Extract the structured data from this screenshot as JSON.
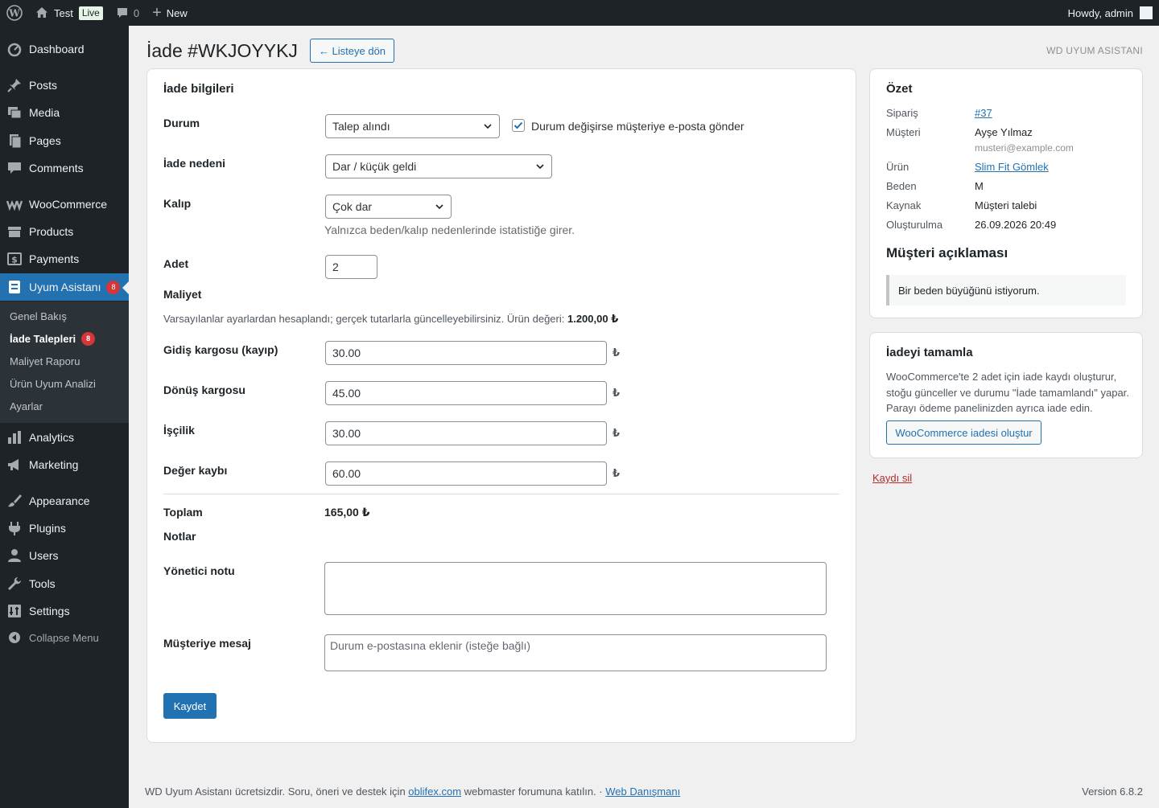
{
  "adminbar": {
    "site_name": "Test",
    "live_badge": "Live",
    "comments_count": "0",
    "new_label": "New",
    "howdy": "Howdy, admin"
  },
  "sidebar": {
    "items": [
      {
        "label": "Dashboard",
        "icon": "dashboard-icon"
      },
      {
        "label": "Posts",
        "icon": "pin-icon"
      },
      {
        "label": "Media",
        "icon": "media-icon"
      },
      {
        "label": "Pages",
        "icon": "pages-icon"
      },
      {
        "label": "Comments",
        "icon": "comment-icon"
      },
      {
        "label": "WooCommerce",
        "icon": "woocommerce-icon"
      },
      {
        "label": "Products",
        "icon": "archive-icon"
      },
      {
        "label": "Payments",
        "icon": "payment-icon"
      },
      {
        "label": "Uyum Asistanı",
        "icon": "uyum-icon",
        "badge": "8"
      },
      {
        "label": "Analytics",
        "icon": "chart-icon"
      },
      {
        "label": "Marketing",
        "icon": "megaphone-icon"
      },
      {
        "label": "Appearance",
        "icon": "brush-icon"
      },
      {
        "label": "Plugins",
        "icon": "plugin-icon"
      },
      {
        "label": "Users",
        "icon": "user-icon"
      },
      {
        "label": "Tools",
        "icon": "wrench-icon"
      },
      {
        "label": "Settings",
        "icon": "settings-icon"
      }
    ],
    "submenu": [
      {
        "label": "Genel Bakış"
      },
      {
        "label": "İade Talepleri",
        "badge": "8"
      },
      {
        "label": "Maliyet Raporu"
      },
      {
        "label": "Ürün Uyum Analizi"
      },
      {
        "label": "Ayarlar"
      }
    ],
    "collapse_label": "Collapse Menu"
  },
  "header": {
    "title": "İade #WKJOYYKJ",
    "back_button": "← Listeye dön",
    "brand": "WD UYUM ASISTANI"
  },
  "form": {
    "section_title": "İade bilgileri",
    "status_label": "Durum",
    "status_value": "Talep alındı",
    "notify_checked": true,
    "notify_label": "Durum değişirse müşteriye e-posta gönder",
    "reason_label": "İade nedeni",
    "reason_value": "Dar / küçük geldi",
    "fit_label": "Kalıp",
    "fit_value": "Çok dar",
    "fit_hint": "Yalnızca beden/kalıp nedenlerinde istatistiğe girer.",
    "qty_label": "Adet",
    "qty_value": "2",
    "cost_title": "Maliyet",
    "cost_desc": "Varsayılanlar ayarlardan hesaplandı; gerçek tutarlarla güncelleyebilirsiniz. Ürün değeri:",
    "product_value": "1.200,00 ₺",
    "currency": "₺",
    "costs": [
      {
        "label": "Gidiş kargosu (kayıp)",
        "value": "30.00"
      },
      {
        "label": "Dönüş kargosu",
        "value": "45.00"
      },
      {
        "label": "İşçilik",
        "value": "30.00"
      },
      {
        "label": "Değer kaybı",
        "value": "60.00"
      }
    ],
    "total_label": "Toplam",
    "total_value": "165,00 ₺",
    "notes_title": "Notlar",
    "admin_note_label": "Yönetici notu",
    "admin_note_value": "",
    "customer_msg_label": "Müşteriye mesaj",
    "customer_msg_placeholder": "Durum e-postasına eklenir (isteğe bağlı)",
    "save_label": "Kaydet"
  },
  "summary": {
    "title": "Özet",
    "rows": [
      {
        "key": "Sipariş",
        "value": "#37"
      },
      {
        "key": "Müşteri",
        "value": "Ayşe Yılmaz",
        "sub": "musteri@example.com"
      },
      {
        "key": "Ürün",
        "value": "Slim Fit Gömlek"
      },
      {
        "key": "Beden",
        "value": "M"
      },
      {
        "key": "Kaynak",
        "value": "Müşteri talebi"
      },
      {
        "key": "Oluşturulma",
        "value": "26.09.2026 20:49"
      }
    ],
    "customer_note_title": "Müşteri açıklaması",
    "customer_note": "Bir beden büyüğünü istiyorum."
  },
  "complete": {
    "title": "İadeyi tamamla",
    "text": "WooCommerce'te 2 adet için iade kaydı oluşturur, stoğu günceller ve durumu \"İade tamamlandı\" yapar. Parayı ödeme panelinizden ayrıca iade edin.",
    "button": "WooCommerce iadesi oluştur"
  },
  "delete_label": "Kaydı sil",
  "footer": {
    "text_before": "WD Uyum Asistanı ücretsizdir. Soru, öneri ve destek için ",
    "link1": "oblifex.com",
    "text_middle": " webmaster forumuna katılın. · ",
    "link2": "Web Danışmanı",
    "version": "Version 6.8.2"
  }
}
